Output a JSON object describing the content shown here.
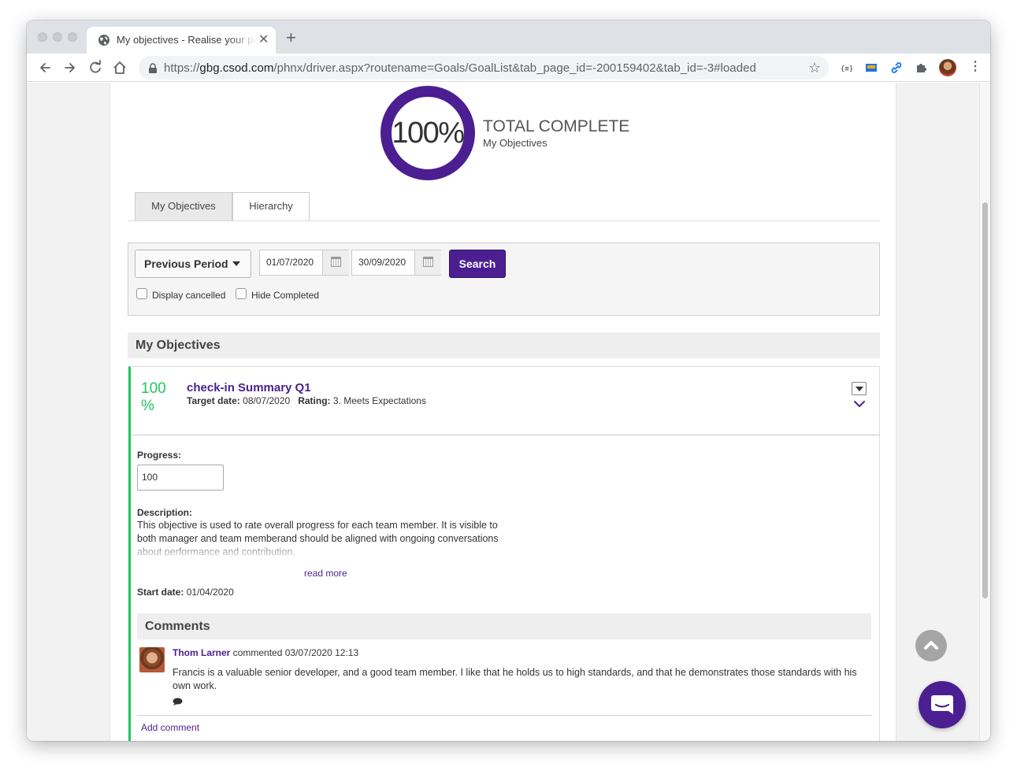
{
  "browser": {
    "tab_title": "My objectives - Realise your po",
    "url_prefix": "https://",
    "url_host": "gbg.csod.com",
    "url_path": "/phnx/driver.aspx?routename=Goals/GoalList&tab_page_id=-200159402&tab_id=-3#loaded",
    "new_tab_symbol": "+",
    "close_symbol": "✕",
    "bookmark_symbol": "☆",
    "menu_symbol": "⋮"
  },
  "summary": {
    "percent": "100%",
    "percent_value": 100,
    "title": "TOTAL COMPLETE",
    "subtitle": "My Objectives",
    "ring_color": "#4b1f91"
  },
  "tabs": [
    {
      "label": "My Objectives",
      "active": true
    },
    {
      "label": "Hierarchy",
      "active": false
    }
  ],
  "filter": {
    "period_label": "Previous Period",
    "start_date": "01/07/2020",
    "end_date": "30/09/2020",
    "search_label": "Search",
    "display_cancelled_label": "Display cancelled",
    "hide_completed_label": "Hide Completed"
  },
  "section_title": "My Objectives",
  "objective": {
    "percent_line1": "100",
    "percent_line2": "%",
    "title": "check-in Summary Q1",
    "target_label": "Target date:",
    "target_value": "08/07/2020",
    "rating_label": "Rating:",
    "rating_value": "3. Meets Expectations",
    "progress_label": "Progress:",
    "progress_value": "100",
    "description_label": "Description:",
    "description": "This objective is used to rate overall progress for each team member. It is visible to both manager and team memberand should be aligned with ongoing conversations about performance and contribution.",
    "read_more": "read more",
    "start_label": "Start date:",
    "start_value": "01/04/2020",
    "accent_color": "#22c55e"
  },
  "comments": {
    "title": "Comments",
    "items": [
      {
        "author": "Thom Larner",
        "meta": " commented 03/07/2020 12:13",
        "text": "Francis is a valuable senior developer, and a good team member.  I like that he holds us to high standards, and that he demonstrates those standards with his own work."
      }
    ],
    "add_label": "Add comment"
  },
  "colors": {
    "brand": "#4b1f91",
    "success": "#22c55e"
  }
}
